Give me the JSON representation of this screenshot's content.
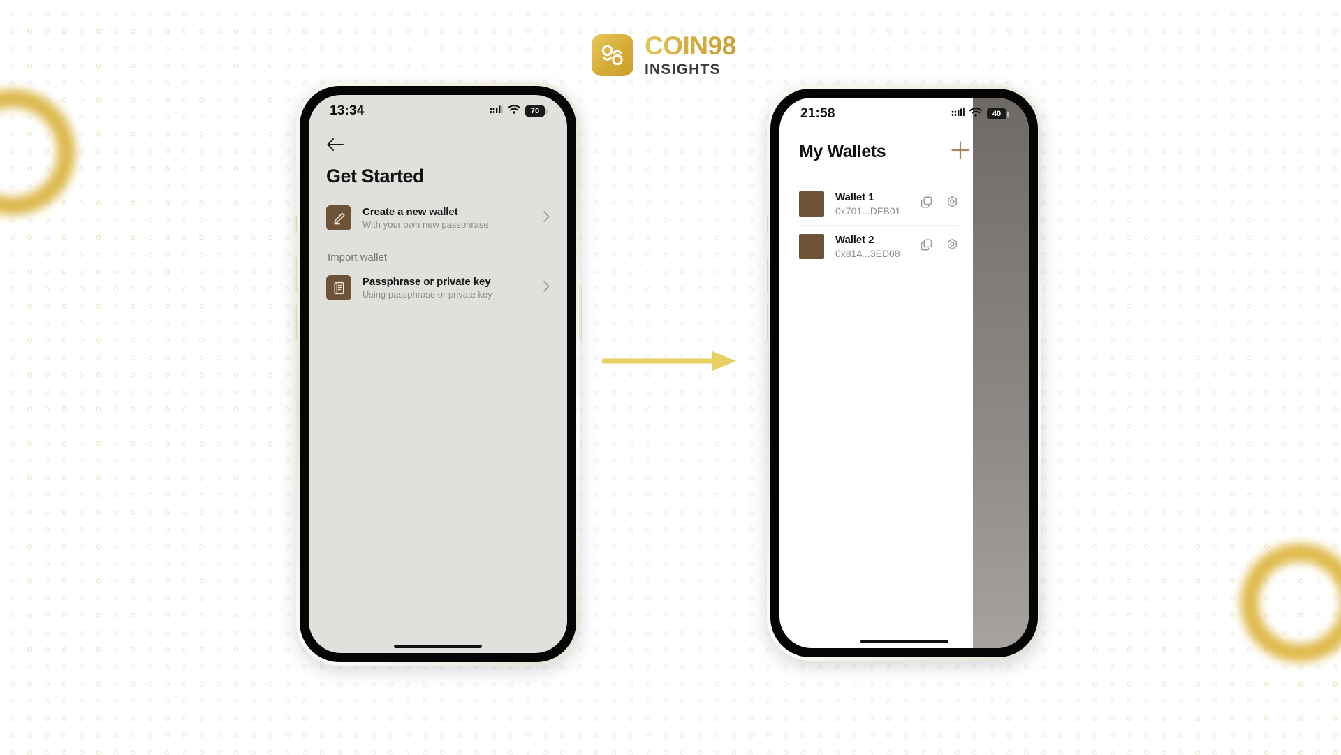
{
  "brand": {
    "mark_icon": "coin98-logo-icon",
    "title": "COIN98",
    "subtitle": "INSIGHTS",
    "gold": "#d4ae3e"
  },
  "flow": {
    "arrow_icon": "right-arrow-icon",
    "arrow_color": "#e8cf62"
  },
  "decor": {
    "ring_left_icon": "gold-ring-decoration",
    "ring_right_icon": "gold-ring-decoration",
    "ring_color": "#d9b23c",
    "dot_color": "#eceef0",
    "dot_gold_color": "#f2e0a8"
  },
  "screen1": {
    "status": {
      "time": "13:34",
      "signal_icon": "cellular-signal-icon",
      "wifi_icon": "wifi-icon",
      "battery_icon": "battery-icon",
      "battery_level": "70"
    },
    "back_icon": "back-arrow-icon",
    "title": "Get Started",
    "primary_options": [
      {
        "icon": "pencil-edit-icon",
        "title": "Create a new wallet",
        "subtitle": "With your own new passphrase",
        "chevron_icon": "chevron-right-icon"
      }
    ],
    "section_label": "Import wallet",
    "import_options": [
      {
        "icon": "document-list-icon",
        "title": "Passphrase or private key",
        "subtitle": "Using passphrase or private key",
        "chevron_icon": "chevron-right-icon"
      }
    ],
    "icon_tile_color": "#6f5339",
    "screen_bg": "#e0e0dd"
  },
  "screen2": {
    "status": {
      "time": "21:58",
      "signal_icon": "cellular-signal-icon",
      "wifi_icon": "wifi-icon",
      "battery_icon": "battery-icon",
      "battery_level": "40"
    },
    "title": "My Wallets",
    "add_icon": "plus-icon",
    "add_icon_color": "#a8845a",
    "wallets": [
      {
        "avatar": "wallet-avatar-icon",
        "name": "Wallet 1",
        "address": "0x701...DFB01",
        "copy_icon": "copy-icon",
        "settings_icon": "gear-icon"
      },
      {
        "avatar": "wallet-avatar-icon",
        "name": "Wallet 2",
        "address": "0x814...3ED08",
        "copy_icon": "copy-icon",
        "settings_icon": "gear-icon"
      }
    ],
    "avatar_color": "#6f5339",
    "screen_bg": "#ffffff"
  }
}
